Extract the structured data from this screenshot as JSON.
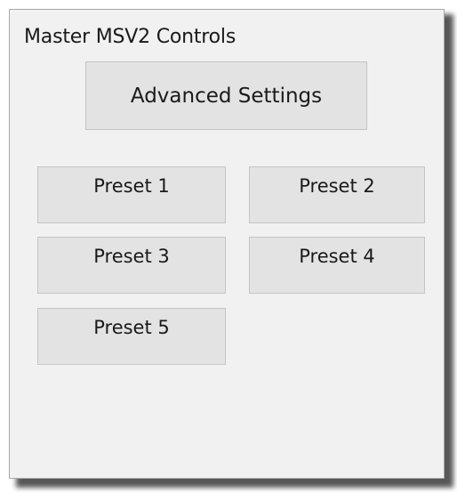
{
  "panel": {
    "title": "Master MSV2 Controls"
  },
  "buttons": {
    "advanced_settings": "Advanced Settings",
    "presets": [
      "Preset 1",
      "Preset 2",
      "Preset 3",
      "Preset 4",
      "Preset 5"
    ]
  }
}
